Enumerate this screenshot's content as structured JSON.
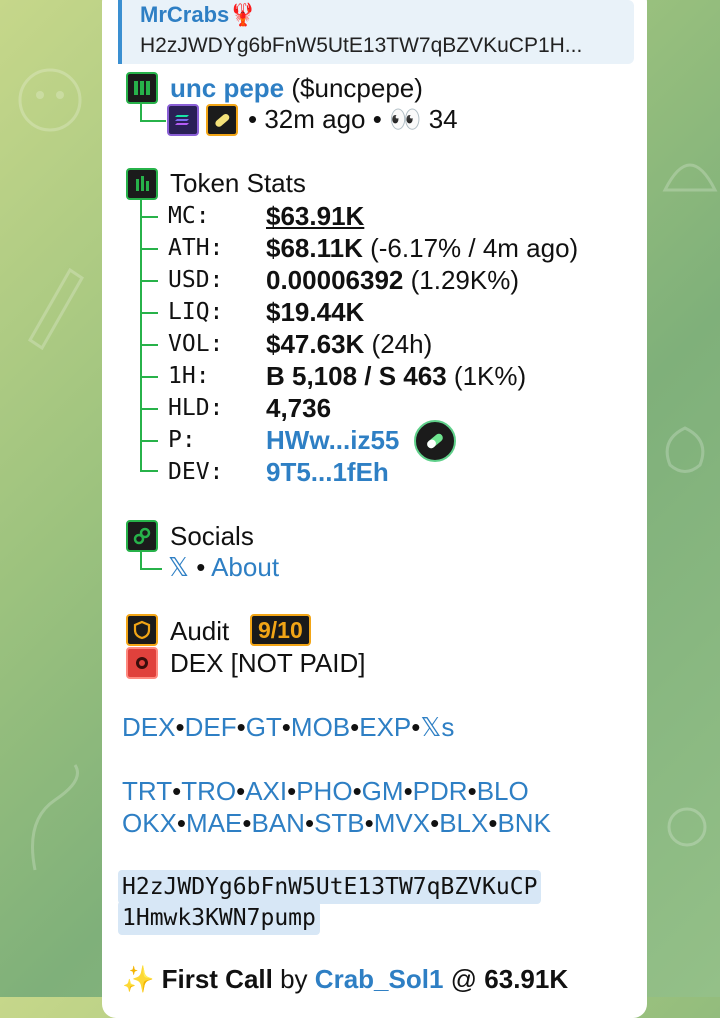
{
  "reply": {
    "sender": "MrCrabs🦞",
    "text": "H2zJWDYg6bFnW5UtE13TW7qBZVKuCP1H..."
  },
  "token": {
    "name": "unc pepe",
    "ticker": "($uncpepe)",
    "age": "• 32m ago •",
    "views_icon": "👀",
    "views": "34"
  },
  "stats": {
    "header": "Token Stats",
    "rows": [
      {
        "label": "MC:",
        "value": "$63.91K",
        "extra": ""
      },
      {
        "label": "ATH:",
        "value": "$68.11K",
        "extra": "(-6.17% / 4m ago)"
      },
      {
        "label": "USD:",
        "value": "0.00006392",
        "extra": "(1.29K%)"
      },
      {
        "label": "LIQ:",
        "value": "$19.44K",
        "extra": ""
      },
      {
        "label": "VOL:",
        "value": "$47.63K",
        "extra": "(24h)"
      },
      {
        "label": "1H:",
        "value": "B 5,108 / S 463",
        "extra": "(1K%)"
      },
      {
        "label": "HLD:",
        "value": "4,736",
        "extra": ""
      },
      {
        "label": "P:",
        "value": "HWw...iz55",
        "extra": ""
      },
      {
        "label": "DEV:",
        "value": "9T5...1fEh",
        "extra": ""
      }
    ]
  },
  "socials": {
    "header": "Socials",
    "x": "𝕏",
    "sep": "•",
    "about": "About"
  },
  "audit": {
    "header": "Audit",
    "score": "9/10",
    "dex_status": "DEX [NOT PAID]"
  },
  "links_row1": [
    "DEX",
    "DEF",
    "GT",
    "MOB",
    "EXP",
    "𝕏s"
  ],
  "links_row2": [
    "TRT",
    "TRO",
    "AXI",
    "PHO",
    "GM",
    "PDR",
    "BLO"
  ],
  "links_row3": [
    "OKX",
    "MAE",
    "BAN",
    "STB",
    "MVX",
    "BLX",
    "BNK"
  ],
  "contract": {
    "line1": "H2zJWDYg6bFnW5UtE13TW7qBZVKuCP",
    "line2": "1Hmwk3KWN7pump"
  },
  "first_call": {
    "sparkle": "✨",
    "label": "First Call",
    "by": "by",
    "user": "Crab_Sol1",
    "at": "@",
    "value": "63.91K"
  },
  "colors": {
    "accent_green": "#27b24a",
    "link_blue": "#2e7fc4",
    "audit_orange": "#f2a516",
    "red_icon": "#e0413c"
  }
}
